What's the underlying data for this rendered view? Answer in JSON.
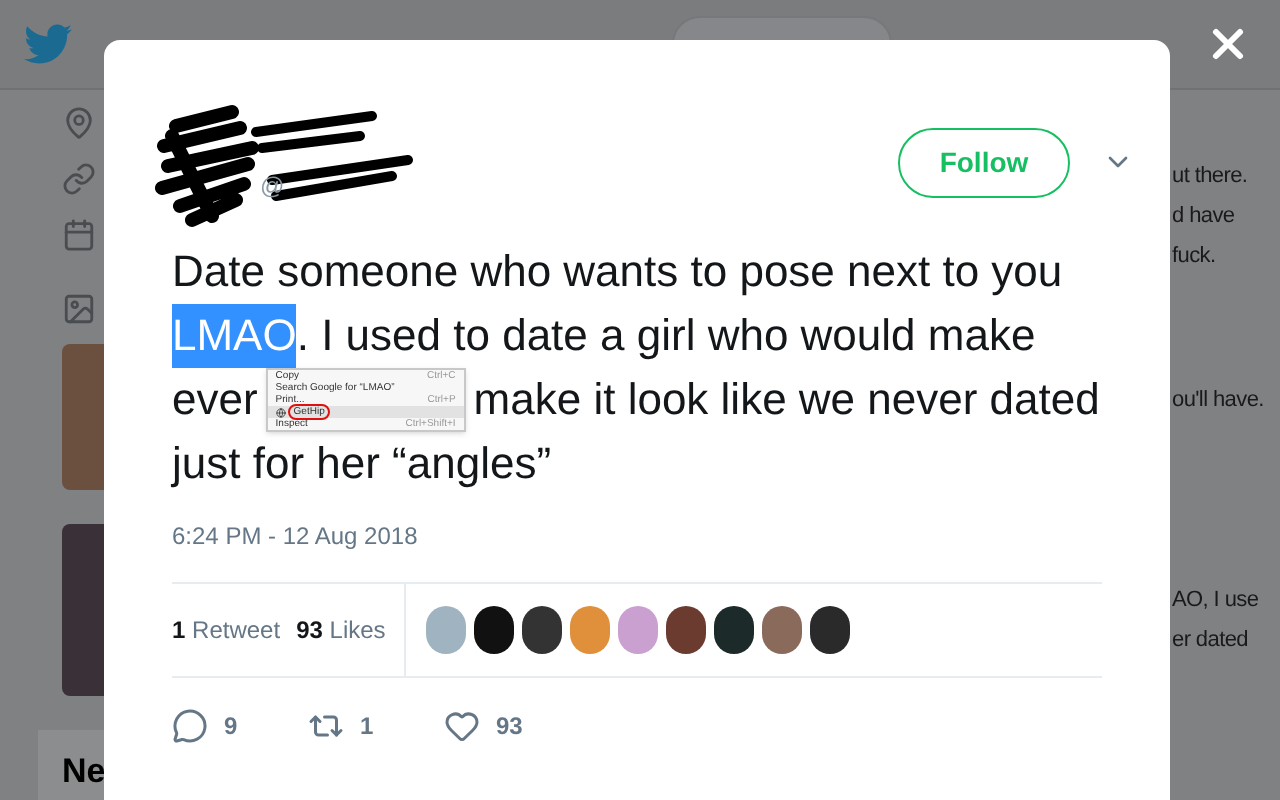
{
  "background": {
    "side_snippets": [
      "ut there.",
      "d have",
      "fuck.",
      "ou'll have.",
      "AO, I use",
      "er dated"
    ],
    "section_heading": "Ne"
  },
  "tweet": {
    "handle_prefix": "@",
    "follow_button": "Follow",
    "lines": [
      {
        "parts": [
          {
            "text": "Date someone who wants to pose next to you",
            "highlighted": false
          }
        ]
      },
      {
        "parts": [
          {
            "text": "LMAO",
            "highlighted": true
          },
          {
            "text": ". I used to date a girl who would make",
            "highlighted": false
          }
        ]
      },
      {
        "parts": [
          {
            "text": "ever",
            "highlighted": false
          },
          {
            "text": "make it look like we never dated",
            "highlighted": false
          }
        ]
      },
      {
        "parts": [
          {
            "text": "just for her “angles”",
            "highlighted": false
          }
        ]
      }
    ],
    "context_menu": [
      {
        "label": "Copy",
        "shortcut": "Ctrl+C",
        "kind": "plain",
        "selected": false
      },
      {
        "label": "Search Google for “LMAO”",
        "kind": "plain",
        "selected": false
      },
      {
        "label": "Print...",
        "shortcut": "Ctrl+P",
        "kind": "plain",
        "selected": false
      },
      {
        "label": "GetHip",
        "kind": "extension",
        "selected": true
      },
      {
        "label": "Inspect",
        "shortcut": "Ctrl+Shift+I",
        "kind": "plain",
        "selected": false
      }
    ],
    "timestamp": "6:24 PM - 12 Aug 2018",
    "stats": [
      {
        "count": "1",
        "label": "Retweet"
      },
      {
        "count": "93",
        "label": "Likes"
      }
    ],
    "likers": [
      {
        "color": "#9fb3c0"
      },
      {
        "color": "#111111"
      },
      {
        "color": "#333333"
      },
      {
        "color": "#e0903a"
      },
      {
        "color": "#c9a0d0"
      },
      {
        "color": "#6b3b30"
      },
      {
        "color": "#1d2a2a"
      },
      {
        "color": "#8a6a5a"
      },
      {
        "color": "#2a2a2a"
      }
    ],
    "actions": [
      {
        "kind": "reply",
        "count": "9"
      },
      {
        "kind": "retweet",
        "count": "1"
      },
      {
        "kind": "like",
        "count": "93"
      }
    ]
  }
}
